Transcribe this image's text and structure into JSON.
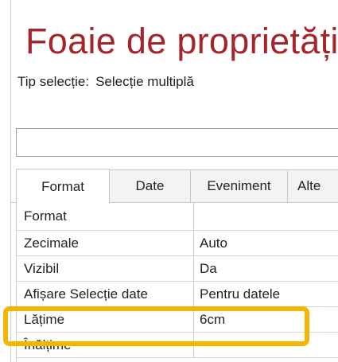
{
  "sheet": {
    "title": "Foaie de proprietăți",
    "selection_label": "Tip selecție:",
    "selection_value": "Selecție multiplă",
    "dropdown_value": ""
  },
  "tabs": [
    "Format",
    "Date",
    "Eveniment",
    "Alte"
  ],
  "properties": [
    {
      "name": "Format",
      "value": ""
    },
    {
      "name": "Zecimale",
      "value": "Auto"
    },
    {
      "name": "Vizibil",
      "value": "Da"
    },
    {
      "name": "Afișare Selecție date",
      "value": "Pentru datele"
    },
    {
      "name": "Lățime",
      "value": "6cm"
    },
    {
      "name": "Înălțime",
      "value": ""
    }
  ],
  "colors": {
    "title": "#a4262c",
    "highlight": "#f4b400"
  }
}
